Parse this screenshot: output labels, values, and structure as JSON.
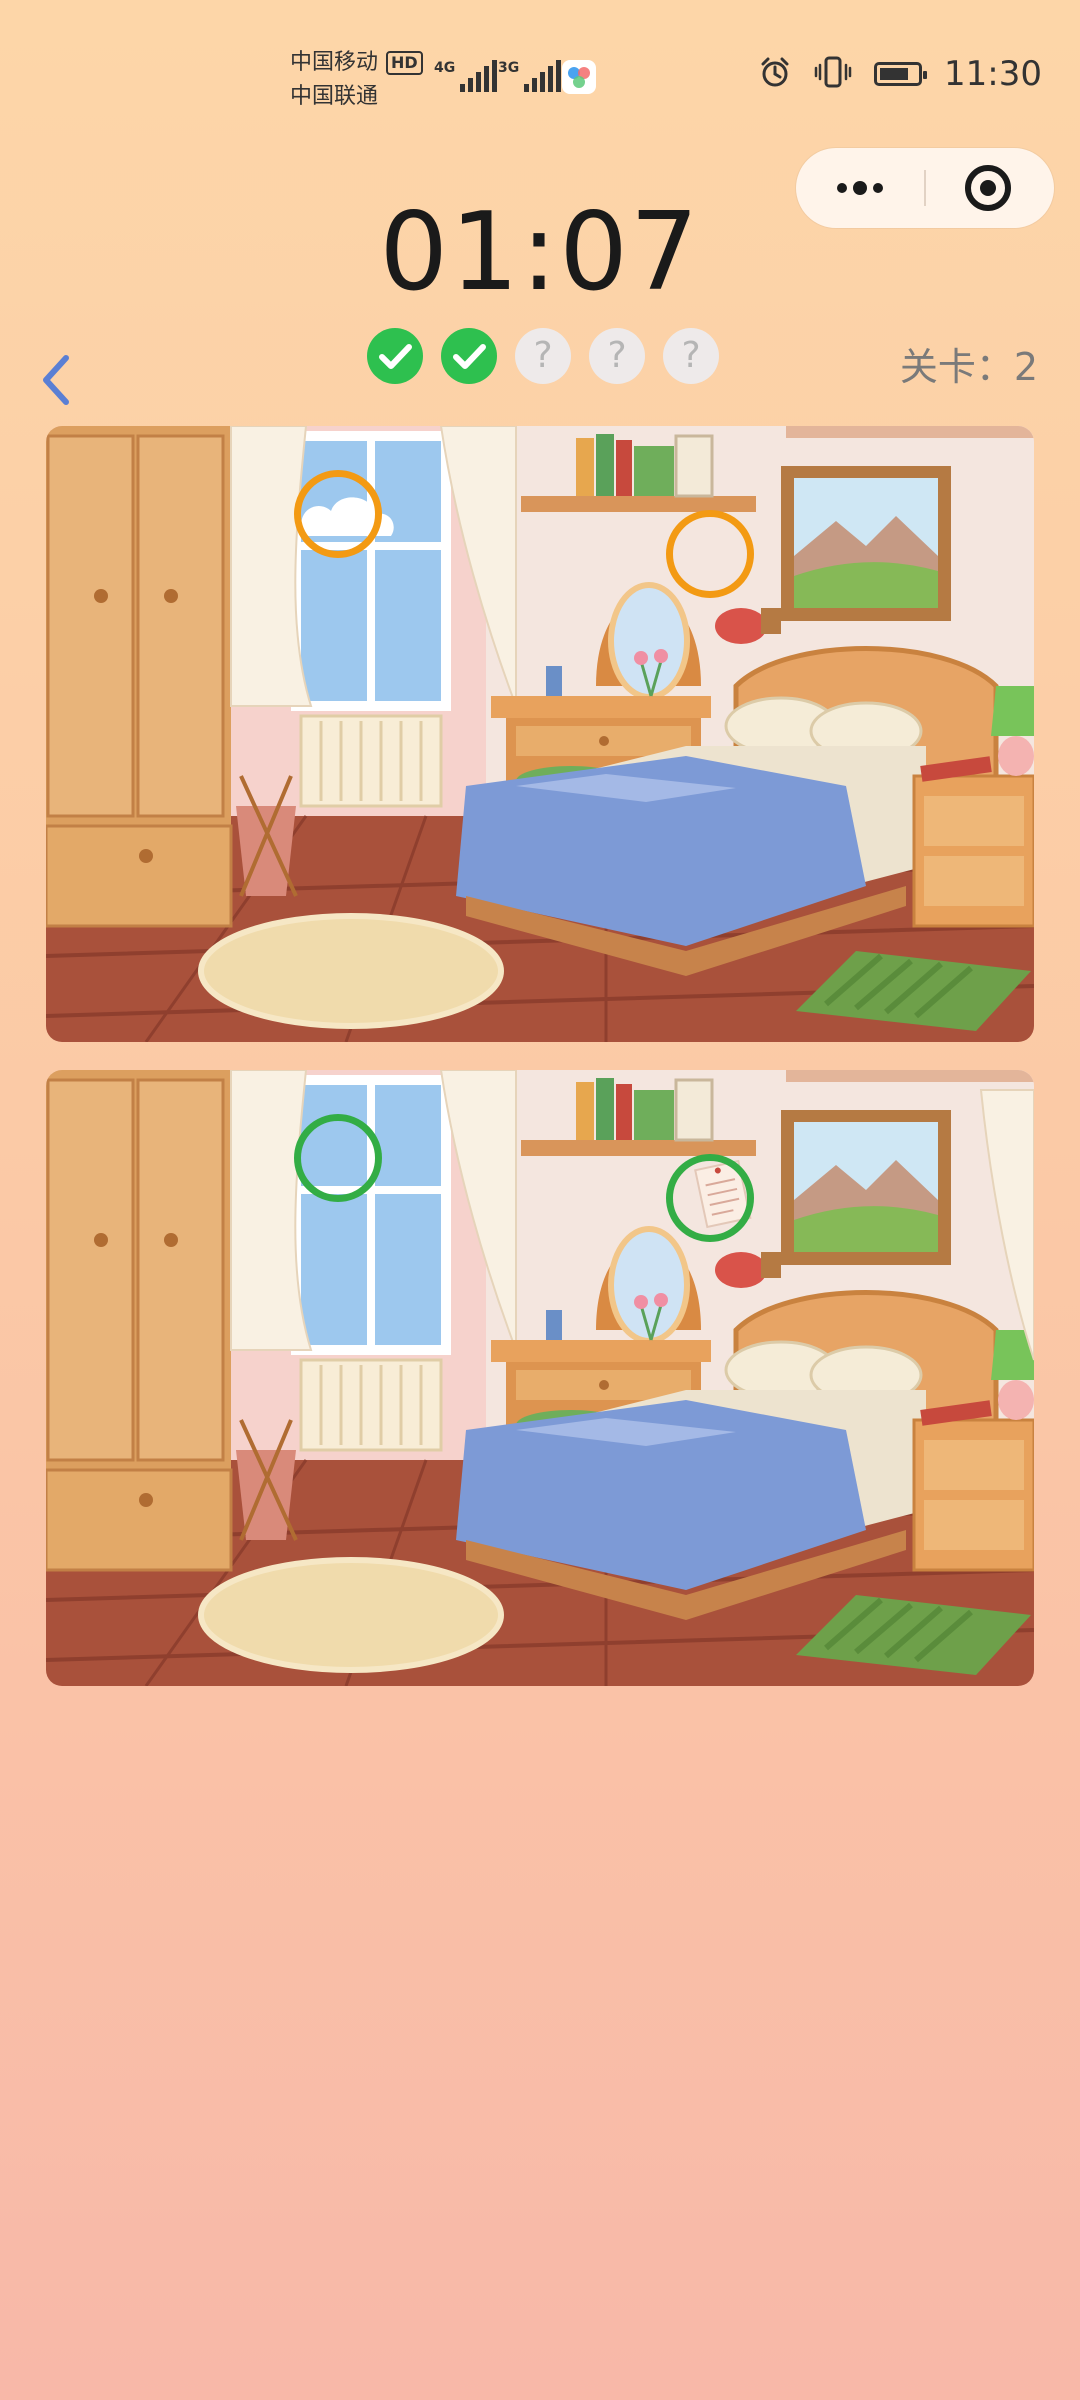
{
  "status_bar": {
    "carrier_1": "中国移动",
    "hd_badge": "HD",
    "carrier_2": "中国联通",
    "net_1": "4G",
    "net_2": "3G",
    "time": "11:30",
    "icons": [
      "alarm-icon",
      "vibrate-icon",
      "battery-icon"
    ]
  },
  "capsule": {
    "more_icon": "more-dots-icon",
    "close_icon": "target-close-icon"
  },
  "game": {
    "timer": "01:07",
    "level_label": "关卡：2",
    "progress": [
      {
        "state": "found",
        "icon": "check-icon"
      },
      {
        "state": "found",
        "icon": "check-icon"
      },
      {
        "state": "pending",
        "symbol": "?"
      },
      {
        "state": "pending",
        "symbol": "?"
      },
      {
        "state": "pending",
        "symbol": "?"
      }
    ],
    "found_count": 2,
    "total_differences": 5
  },
  "markers": {
    "top_1": "orange",
    "top_2": "orange",
    "bottom_1": "green",
    "bottom_2": "green"
  },
  "colors": {
    "found": "#2ec04f",
    "marker_top": "#f39a13",
    "marker_bottom": "#33ad45",
    "back_arrow": "#5a7fd4"
  }
}
